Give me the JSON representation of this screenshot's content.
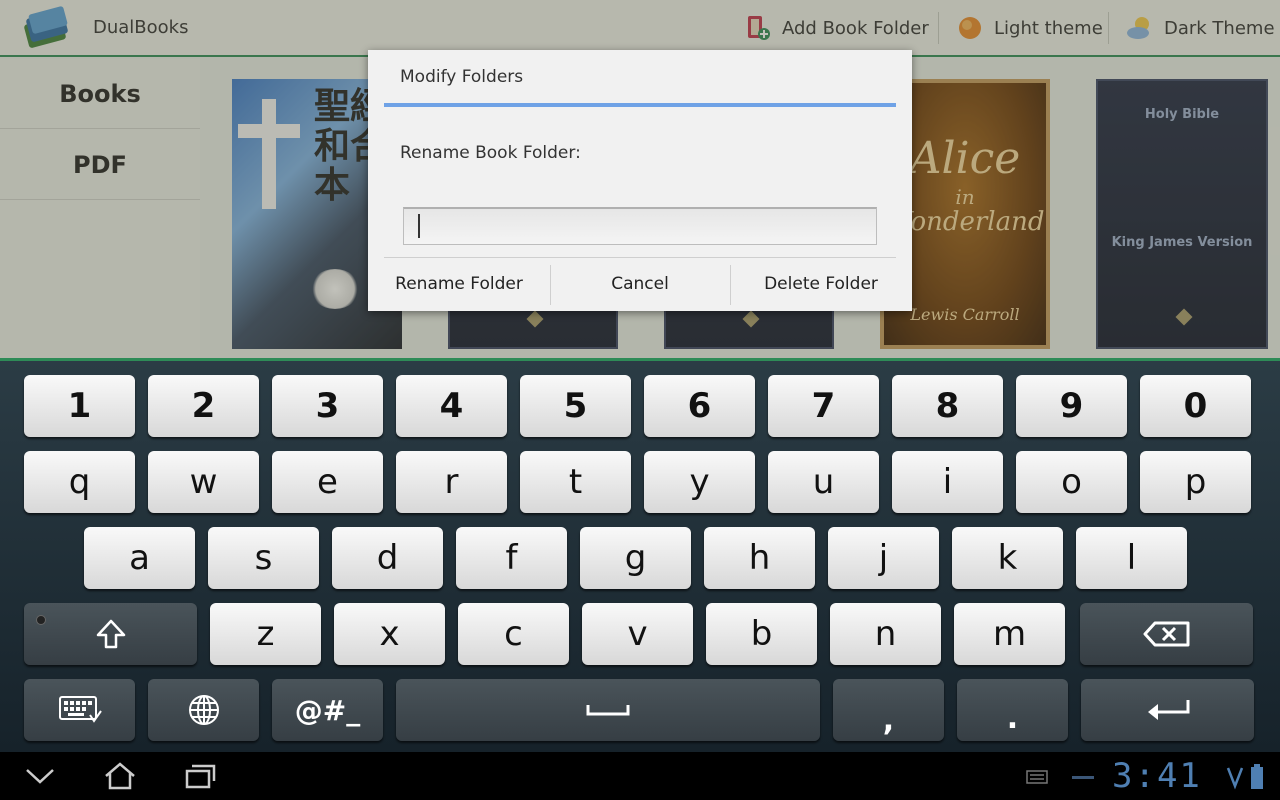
{
  "app": {
    "title": "DualBooks"
  },
  "actions": {
    "add_folder": "Add Book Folder",
    "light_theme": "Light theme",
    "dark_theme": "Dark Theme"
  },
  "sidebar": {
    "items": [
      {
        "label": "Books"
      },
      {
        "label": "PDF"
      }
    ]
  },
  "books": {
    "book1": {
      "title": "聖經 和合本"
    },
    "book4": {
      "line1": "Alice",
      "line2": "in",
      "line3": "Wonderland",
      "author": "Lewis Carroll"
    },
    "book5": {
      "title": "Holy Bible",
      "subtitle": "King James Version"
    }
  },
  "dialog": {
    "title": "Modify Folders",
    "label": "Rename Book Folder:",
    "input_value": "",
    "buttons": {
      "rename": "Rename Folder",
      "cancel": "Cancel",
      "delete": "Delete Folder"
    }
  },
  "keyboard": {
    "row_numbers": [
      "1",
      "2",
      "3",
      "4",
      "5",
      "6",
      "7",
      "8",
      "9",
      "0"
    ],
    "row_top": [
      "q",
      "w",
      "e",
      "r",
      "t",
      "y",
      "u",
      "i",
      "o",
      "p"
    ],
    "row_home": [
      "a",
      "s",
      "d",
      "f",
      "g",
      "h",
      "j",
      "k",
      "l"
    ],
    "row_bottom": [
      "z",
      "x",
      "c",
      "v",
      "b",
      "n",
      "m"
    ],
    "symbols_label": "@#_",
    "comma": ",",
    "period": "."
  },
  "status": {
    "time": "3:41"
  },
  "colors": {
    "accent_green": "#2e8b57",
    "dialog_rule": "#6fa2e6",
    "clock": "#4f7fb2"
  }
}
